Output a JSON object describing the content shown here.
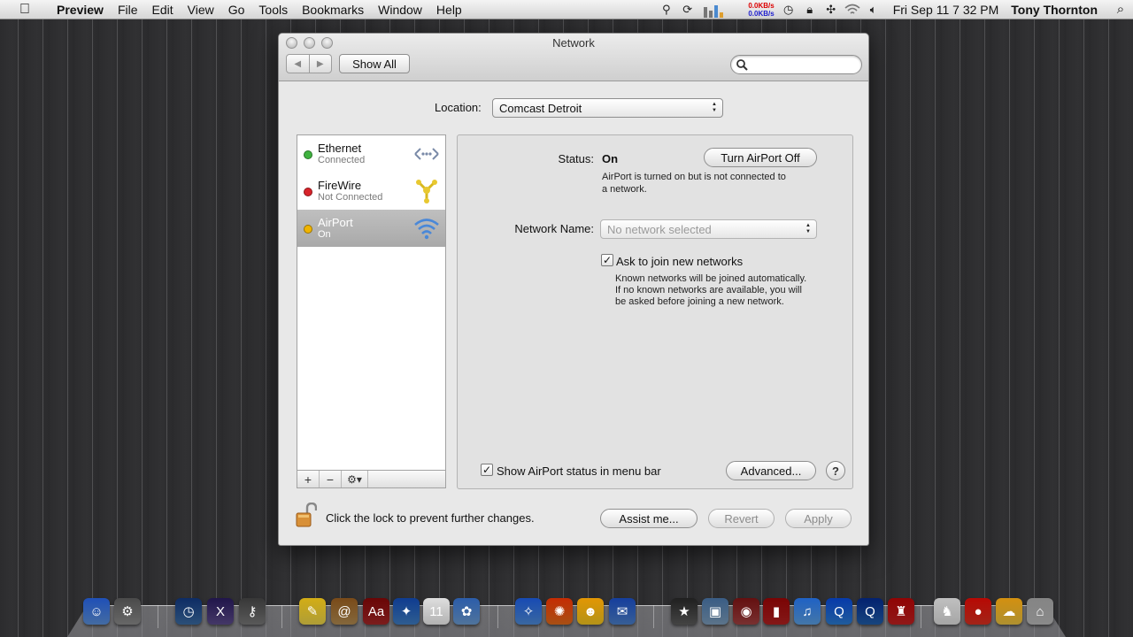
{
  "menubar": {
    "app": "Preview",
    "menus": [
      "File",
      "Edit",
      "View",
      "Go",
      "Tools",
      "Bookmarks",
      "Window",
      "Help"
    ],
    "netspeed_up": "0.0KB/s",
    "netspeed_down": "0.0KB/s",
    "clock": "Fri Sep 11  7 32 PM",
    "user": "Tony Thornton"
  },
  "window": {
    "title": "Network",
    "show_all_label": "Show All",
    "search_placeholder": ""
  },
  "location": {
    "label": "Location:",
    "value": "Comcast Detroit"
  },
  "services": [
    {
      "name": "Ethernet",
      "status": "Connected",
      "dot_color": "#3fb23f",
      "icon": "ethernet-icon"
    },
    {
      "name": "FireWire",
      "status": "Not Connected",
      "dot_color": "#d8232a",
      "icon": "firewire-icon"
    },
    {
      "name": "AirPort",
      "status": "On",
      "dot_color": "#f0b400",
      "icon": "wifi-icon",
      "selected": true
    }
  ],
  "detail": {
    "status_label": "Status:",
    "status_value": "On",
    "toggle_button": "Turn AirPort Off",
    "status_desc_1": "AirPort is turned on but is not connected to",
    "status_desc_2": "a network.",
    "network_name_label": "Network Name:",
    "network_name_value": "No network selected",
    "ask_join_label": "Ask to join new networks",
    "ask_join_checked": true,
    "ask_join_desc_1": "Known networks will be joined automatically.",
    "ask_join_desc_2": "If no known networks are available, you will",
    "ask_join_desc_3": "be asked before joining a new network.",
    "show_status_label": "Show AirPort status in menu bar",
    "show_status_checked": true,
    "advanced_button": "Advanced...",
    "help_button": "?"
  },
  "bottom": {
    "lock_text": "Click the lock to prevent further changes.",
    "assist_button": "Assist me...",
    "revert_button": "Revert",
    "apply_button": "Apply"
  },
  "list_toolbar": {
    "add": "+",
    "remove": "−",
    "gear": "⚙▾"
  },
  "dock": [
    {
      "name": "finder-icon",
      "color": "#5a8fd8",
      "glyph": "☺"
    },
    {
      "name": "system-preferences-icon",
      "color": "#8a8a8a",
      "glyph": "⚙"
    },
    {
      "name": "time-machine-icon",
      "color": "#3a6aa0",
      "glyph": "◷"
    },
    {
      "name": "mac-os-x-icon",
      "color": "#5b4a8a",
      "glyph": "X"
    },
    {
      "name": "keychain-icon",
      "color": "#777777",
      "glyph": "⚷"
    },
    {
      "name": "stickies-icon",
      "color": "#e8d24a",
      "glyph": "✎"
    },
    {
      "name": "address-book-icon",
      "color": "#b08a50",
      "glyph": "@"
    },
    {
      "name": "dictionary-icon",
      "color": "#a42626",
      "glyph": "Aa"
    },
    {
      "name": "preview-icon",
      "color": "#3e7cc0",
      "glyph": "✦"
    },
    {
      "name": "ical-icon",
      "color": "#eeeeee",
      "glyph": "11"
    },
    {
      "name": "photo-icon",
      "color": "#6a9ad0",
      "glyph": "✿"
    },
    {
      "name": "safari-icon",
      "color": "#4d8ad6",
      "glyph": "✧"
    },
    {
      "name": "firefox-icon",
      "color": "#e06a1a",
      "glyph": "✺"
    },
    {
      "name": "messenger-icon",
      "color": "#f0c420",
      "glyph": "☻"
    },
    {
      "name": "ichat-icon",
      "color": "#4a7ec8",
      "glyph": "✉"
    },
    {
      "name": "imovie-icon",
      "color": "#5a5a5a",
      "glyph": "★"
    },
    {
      "name": "iphoto-icon",
      "color": "#7a9ab8",
      "glyph": "▣"
    },
    {
      "name": "photo-booth-icon",
      "color": "#a04040",
      "glyph": "◉"
    },
    {
      "name": "front-row-icon",
      "color": "#b02020",
      "glyph": "▮"
    },
    {
      "name": "itunes-icon",
      "color": "#5a9ee0",
      "glyph": "♫"
    },
    {
      "name": "quicktime-icon",
      "color": "#2a7ad0",
      "glyph": "Q"
    },
    {
      "name": "qt-player-icon",
      "color": "#1e5ca8",
      "glyph": "Q"
    },
    {
      "name": "chair-icon",
      "color": "#c02020",
      "glyph": "♜"
    },
    {
      "name": "cow-icon",
      "color": "#dddddd",
      "glyph": "♞"
    },
    {
      "name": "tomato-icon",
      "color": "#d83020",
      "glyph": "●"
    },
    {
      "name": "weather-icon",
      "color": "#e8c040",
      "glyph": "☁"
    },
    {
      "name": "trash-icon",
      "color": "#b8b8b8",
      "glyph": "⌂"
    }
  ]
}
